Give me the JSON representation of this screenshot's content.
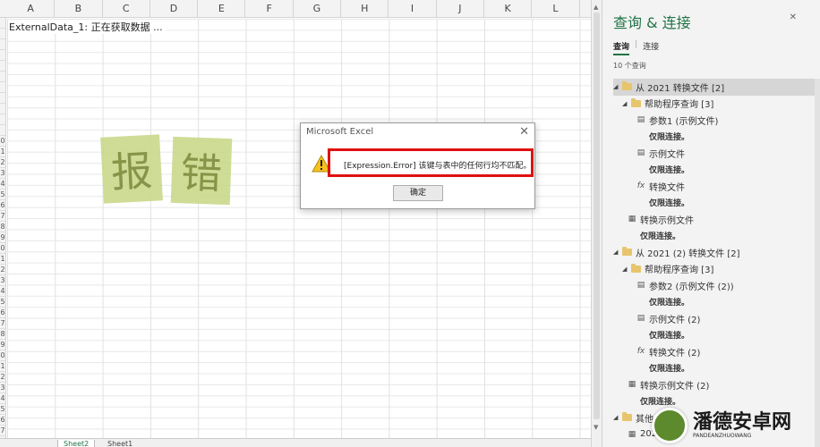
{
  "sheet": {
    "columns": [
      "A",
      "B",
      "C",
      "D",
      "E",
      "F",
      "G",
      "H",
      "I",
      "J",
      "K",
      "L"
    ],
    "row_numbers": [
      "",
      "",
      "",
      "",
      "",
      "",
      "",
      "",
      "",
      "",
      "",
      "0",
      "1",
      "2",
      "3",
      "4",
      "5",
      "6",
      "7",
      "8",
      "9",
      "0",
      "1",
      "2",
      "3",
      "4",
      "5",
      "6",
      "7",
      "8",
      "9",
      "0",
      "1",
      "2",
      "3",
      "4",
      "5",
      "6",
      "7"
    ],
    "status_text": "ExternalData_1: 正在获取数据 ...",
    "stamps": [
      "报",
      "错"
    ],
    "tabs": [
      "Sheet2",
      "Sheet1"
    ]
  },
  "dialog": {
    "title": "Microsoft Excel",
    "close": "✕",
    "message": "[Expression.Error] 该键与表中的任何行均不匹配。",
    "ok_label": "确定"
  },
  "pane": {
    "title": "查询 & 连接",
    "close": "✕",
    "tabs": [
      "查询",
      "连接"
    ],
    "count": "10 个查询",
    "items": [
      {
        "kind": "group",
        "label": "从 2021 转换文件 [2]"
      },
      {
        "kind": "folder",
        "label": "帮助程序查询 [3]"
      },
      {
        "kind": "query",
        "label": "参数1 (示例文件)",
        "icon": "▤"
      },
      {
        "kind": "sub",
        "label": "仅限连接。"
      },
      {
        "kind": "query",
        "label": "示例文件",
        "icon": "▤"
      },
      {
        "kind": "sub",
        "label": "仅限连接。"
      },
      {
        "kind": "query",
        "label": "转换文件",
        "icon": "fx"
      },
      {
        "kind": "sub",
        "label": "仅限连接。"
      },
      {
        "kind": "query2",
        "label": "转换示例文件",
        "icon": "▦"
      },
      {
        "kind": "sub2",
        "label": "仅限连接。"
      },
      {
        "kind": "group",
        "label": "从 2021 (2) 转换文件 [2]"
      },
      {
        "kind": "folder",
        "label": "帮助程序查询 [3]"
      },
      {
        "kind": "query",
        "label": "参数2 (示例文件 (2))",
        "icon": "▤"
      },
      {
        "kind": "sub",
        "label": "仅限连接。"
      },
      {
        "kind": "query",
        "label": "示例文件 (2)",
        "icon": "▤"
      },
      {
        "kind": "sub",
        "label": "仅限连接。"
      },
      {
        "kind": "query",
        "label": "转换文件 (2)",
        "icon": "fx"
      },
      {
        "kind": "sub",
        "label": "仅限连接。"
      },
      {
        "kind": "query2",
        "label": "转换示例文件 (2)",
        "icon": "▦"
      },
      {
        "kind": "sub2",
        "label": "仅限连接。"
      },
      {
        "kind": "group",
        "label": "其他"
      },
      {
        "kind": "query2",
        "label": "2021",
        "icon": "▦"
      }
    ]
  },
  "watermark": {
    "text": "潘德安卓网",
    "sub": "PANDEANZHUOWANG"
  }
}
